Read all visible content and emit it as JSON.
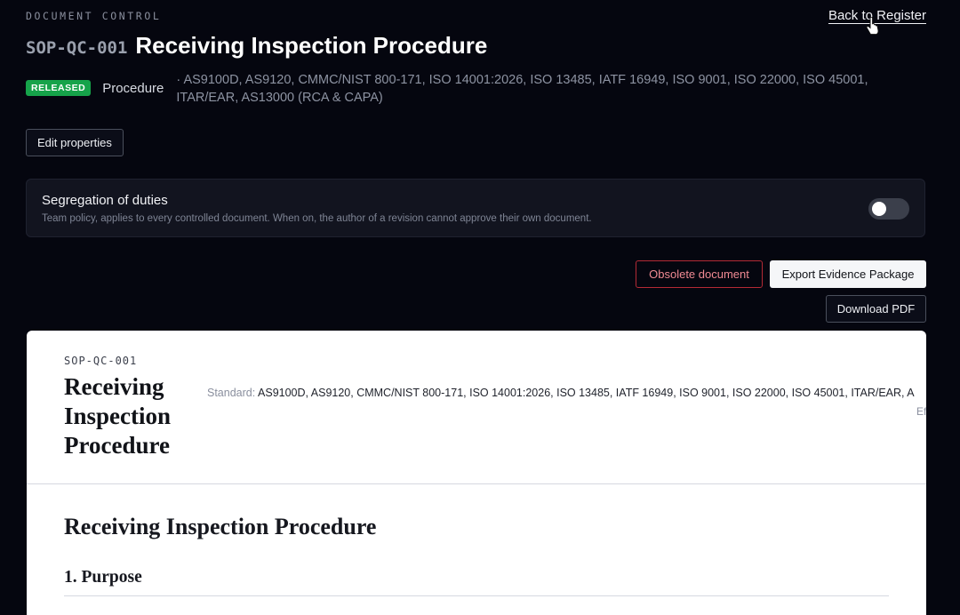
{
  "header": {
    "section_label": "DOCUMENT CONTROL",
    "back_link": "Back to Register",
    "doc_code": "SOP-QC-001",
    "doc_title": "Receiving Inspection Procedure",
    "status_badge": "RELEASED",
    "doc_type": "Procedure",
    "standards": "· AS9100D, AS9120, CMMC/NIST 800-171, ISO 14001:2026, ISO 13485, IATF 16949, ISO 9001, ISO 22000, ISO 45001, ITAR/EAR, AS13000 (RCA & CAPA)"
  },
  "actions": {
    "edit_properties": "Edit properties",
    "obsolete": "Obsolete document",
    "export": "Export Evidence Package",
    "download_pdf": "Download PDF"
  },
  "segregation": {
    "title": "Segregation of duties",
    "description": "Team policy, applies to every controlled document. When on, the author of a revision cannot approve their own document.",
    "enabled": false
  },
  "paper": {
    "code": "SOP-QC-001",
    "title": "Receiving Inspection Procedure",
    "standard_label": "Standard:",
    "standard_value": "AS9100D, AS9120, CMMC/NIST 800-171, ISO 14001:2026, ISO 13485, IATF 16949, ISO 9001, ISO 22000, ISO 45001, ITAR/EAR, A",
    "effective_fragment": "Ef",
    "heading": "Receiving Inspection Procedure",
    "section_1": "1. Purpose"
  },
  "colors": {
    "background": "#05060f",
    "released": "#16a34a",
    "danger": "#b42a35"
  },
  "icons": {
    "cursor": "hand-pointer-icon"
  }
}
